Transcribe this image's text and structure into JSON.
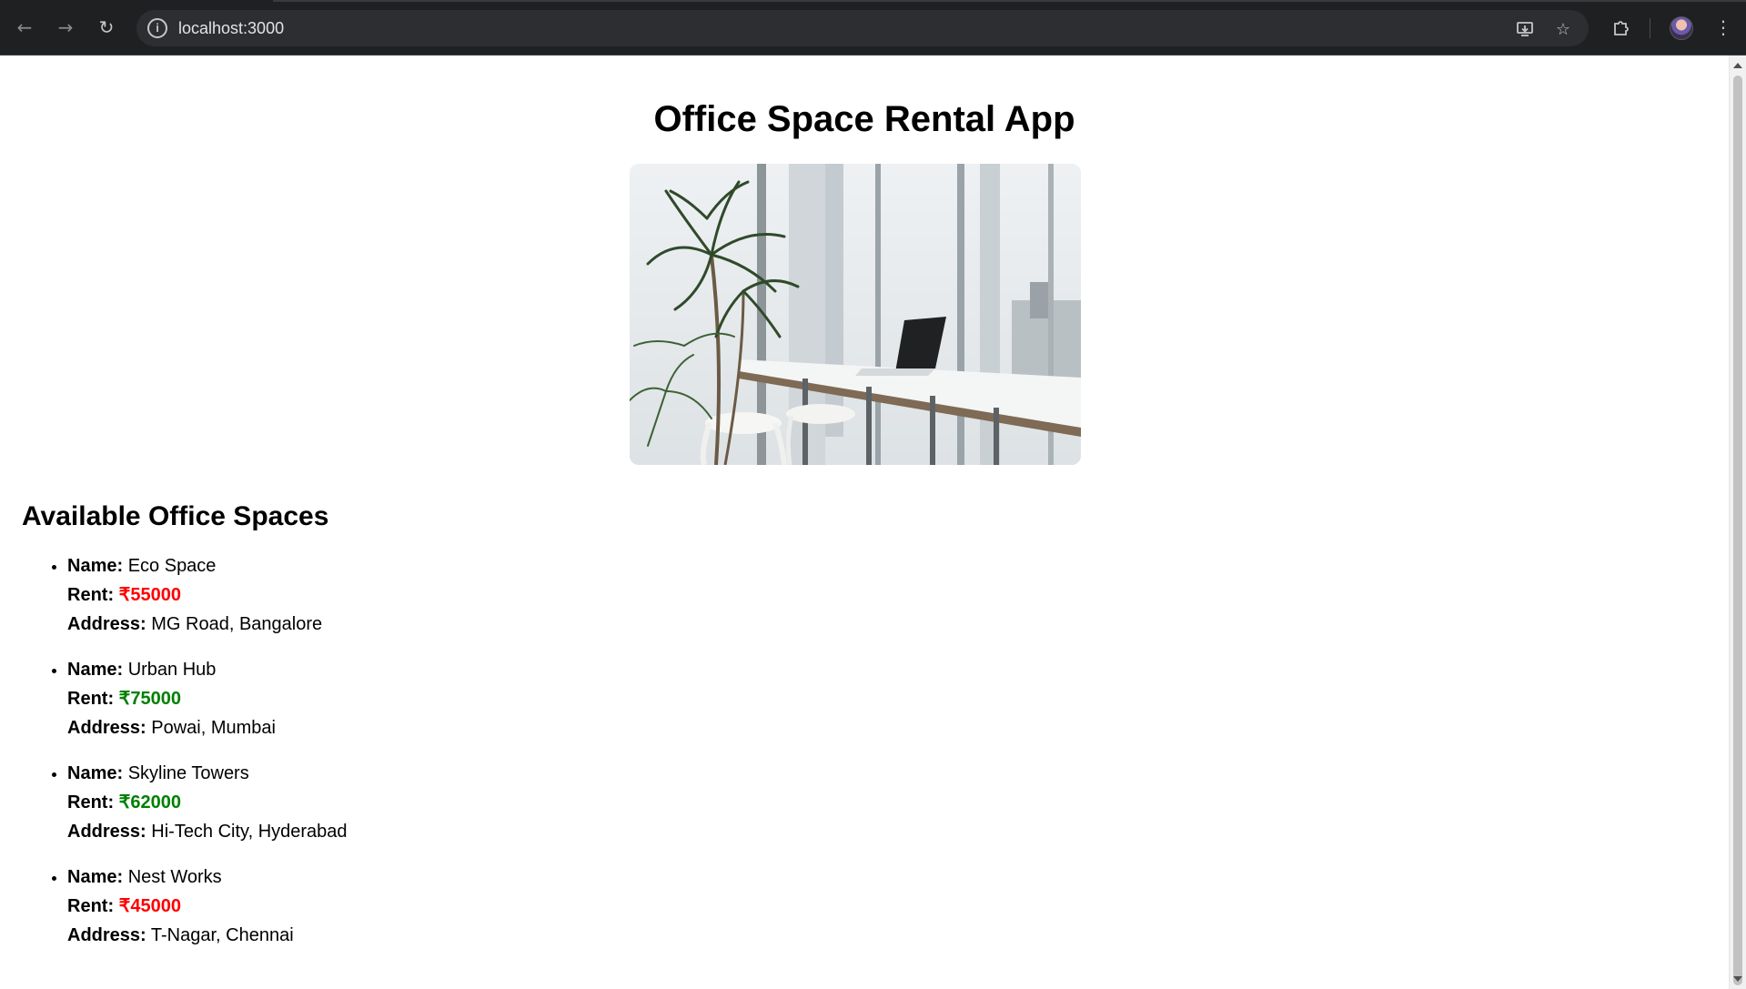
{
  "browser": {
    "url": "localhost:3000"
  },
  "page": {
    "title": "Office Space Rental App",
    "section_title": "Available Office Spaces",
    "labels": {
      "name": "Name:",
      "rent": "Rent:",
      "address": "Address:"
    }
  },
  "colors": {
    "rent_high": "#008000",
    "rent_low": "#ff0000"
  },
  "offices": [
    {
      "name": "Eco Space",
      "rent": "₹55000",
      "rent_color": "#ff0000",
      "address": "MG Road, Bangalore"
    },
    {
      "name": "Urban Hub",
      "rent": "₹75000",
      "rent_color": "#008000",
      "address": "Powai, Mumbai"
    },
    {
      "name": "Skyline Towers",
      "rent": "₹62000",
      "rent_color": "#008000",
      "address": "Hi-Tech City, Hyderabad"
    },
    {
      "name": "Nest Works",
      "rent": "₹45000",
      "rent_color": "#ff0000",
      "address": "T-Nagar, Chennai"
    }
  ]
}
